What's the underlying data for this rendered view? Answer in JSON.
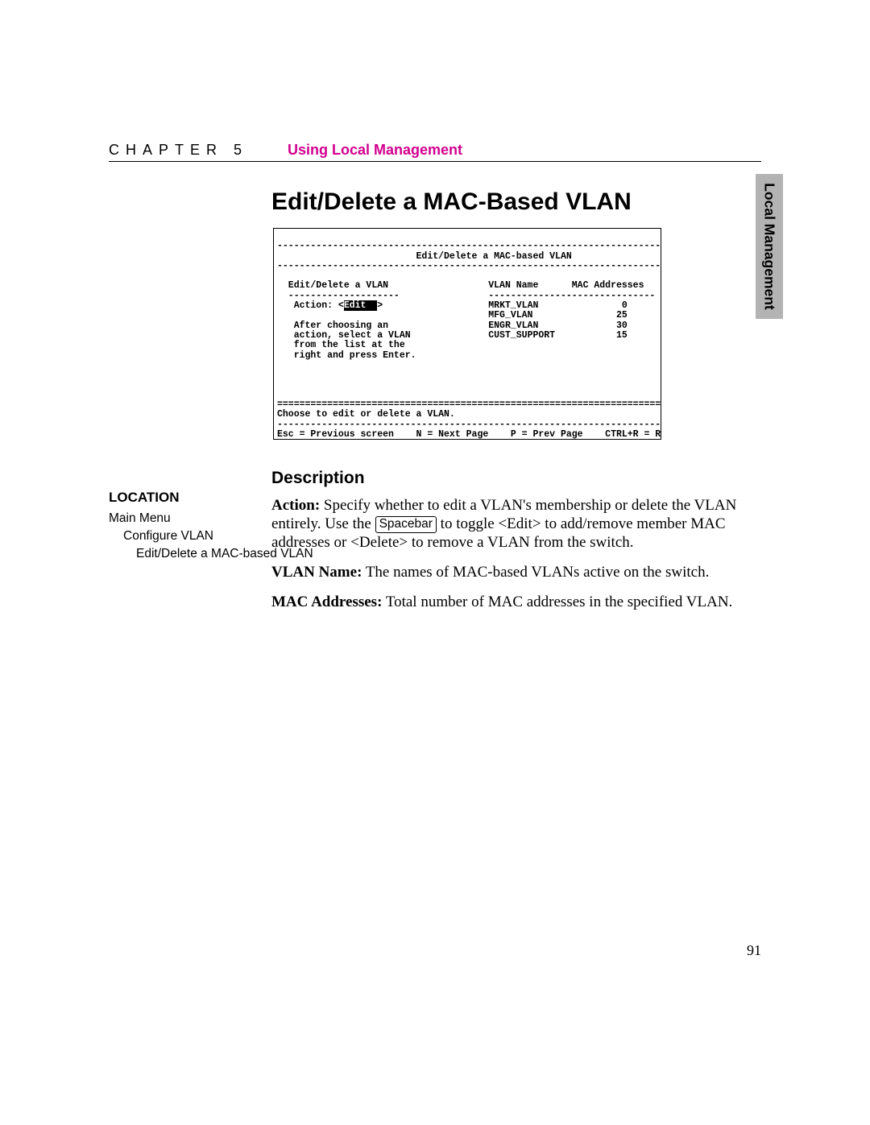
{
  "header": {
    "chapter": "CHAPTER 5",
    "title": "Using Local Management"
  },
  "side_tab": "Local Management",
  "main_title": "Edit/Delete a MAC-Based VLAN",
  "terminal": {
    "dash80": "--------------------------------------------------------------------------------",
    "eq80": "================================================================================",
    "title_line": "                         Edit/Delete a MAC-based VLAN",
    "left_block_header": "  Edit/Delete a VLAN",
    "left_dash": "  --------------------",
    "action_prefix": "   Action: <",
    "action_value": "Edit  ",
    "action_suffix": ">",
    "instr_l1": "   After choosing an",
    "instr_l2": "   action, select a VLAN",
    "instr_l3": "   from the list at the",
    "instr_l4": "   right and press Enter.",
    "cols_head": "                                      VLAN Name      MAC Addresses",
    "cols_dash": "                                      ------------------------------",
    "rows": [
      "                                      MRKT_VLAN               0",
      "                                      MFG_VLAN               25",
      "                                      ENGR_VLAN              30",
      "                                      CUST_SUPPORT           15"
    ],
    "prompt": "Choose to edit or delete a VLAN.",
    "footer": "Esc = Previous screen    N = Next Page    P = Prev Page    CTRL+R = Refresh"
  },
  "description": {
    "heading": "Description",
    "action_label": "Action:",
    "action_p1": "  Specify whether to edit a VLAN's membership or delete the VLAN entirely. Use the ",
    "keycap": "Spacebar",
    "action_p2": " to toggle <Edit> to add/remove member MAC addresses or <Delete> to remove a VLAN from the switch.",
    "vlanname_label": "VLAN Name:",
    "vlanname_text": " The names of MAC-based VLANs active on the switch.",
    "mac_label": "MAC Addresses:",
    "mac_text": " Total number of MAC addresses in the specified VLAN."
  },
  "location": {
    "heading": "LOCATION",
    "l1": "Main Menu",
    "l2": "Configure VLAN",
    "l3": "Edit/Delete a MAC-based VLAN"
  },
  "page_number": "91"
}
